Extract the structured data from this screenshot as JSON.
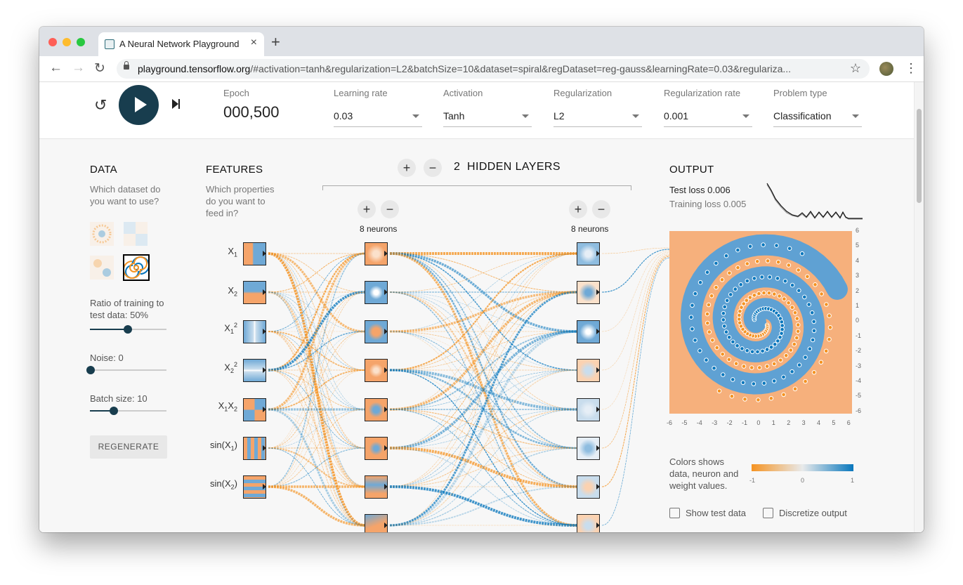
{
  "browser": {
    "tab_title": "A Neural Network Playground",
    "tab_close": "×",
    "new_tab": "+",
    "url_host": "playground.tensorflow.org",
    "url_rest": "/#activation=tanh&regularization=L2&batchSize=10&dataset=spiral&regDataset=reg-gauss&learningRate=0.03&regulariza...",
    "back": "←",
    "forward": "→",
    "reload": "↻",
    "star": "☆",
    "menu": "⋮"
  },
  "controls": {
    "reset_icon": "↺",
    "epoch_label": "Epoch",
    "epoch_value": "000,500",
    "learning_rate_label": "Learning rate",
    "learning_rate_value": "0.03",
    "activation_label": "Activation",
    "activation_value": "Tanh",
    "regularization_label": "Regularization",
    "regularization_value": "L2",
    "reg_rate_label": "Regularization rate",
    "reg_rate_value": "0.001",
    "problem_label": "Problem type",
    "problem_value": "Classification"
  },
  "data_panel": {
    "title": "DATA",
    "desc_line1": "Which dataset do",
    "desc_line2": "you want to use?",
    "selected_dataset": "spiral",
    "ratio_label_line1": "Ratio of training to",
    "ratio_label_line2": "test data:  50%",
    "ratio_value": 50,
    "noise_label": "Noise:  0",
    "noise_value": 0,
    "batch_label": "Batch size:  10",
    "batch_value": 10,
    "regenerate": "REGENERATE"
  },
  "features_panel": {
    "title": "FEATURES",
    "desc_line1": "Which properties",
    "desc_line2": "do you want to",
    "desc_line3": "feed in?"
  },
  "network": {
    "add": "+",
    "remove": "−",
    "hidden_count": "2",
    "hidden_label": "HIDDEN LAYERS",
    "layer1_neurons": "8 neurons",
    "layer2_neurons": "8 neurons"
  },
  "output_panel": {
    "title": "OUTPUT",
    "test_loss": "Test loss 0.006",
    "training_loss": "Training loss 0.005",
    "y_ticks": [
      "6",
      "5",
      "4",
      "3",
      "2",
      "1",
      "0",
      "-1",
      "-2",
      "-3",
      "-4",
      "-5",
      "-6"
    ],
    "x_ticks": [
      "-6",
      "-5",
      "-4",
      "-3",
      "-2",
      "-1",
      "0",
      "1",
      "2",
      "3",
      "4",
      "5",
      "6"
    ],
    "legend_line1": "Colors shows",
    "legend_line2": "data, neuron and",
    "legend_line3": "weight values.",
    "legend_min": "-1",
    "legend_mid": "0",
    "legend_max": "1",
    "show_test": "Show test data",
    "discretize": "Discretize output"
  },
  "colors": {
    "orange": "#f59322",
    "blue": "#0877bd",
    "dark": "#183d4e"
  }
}
